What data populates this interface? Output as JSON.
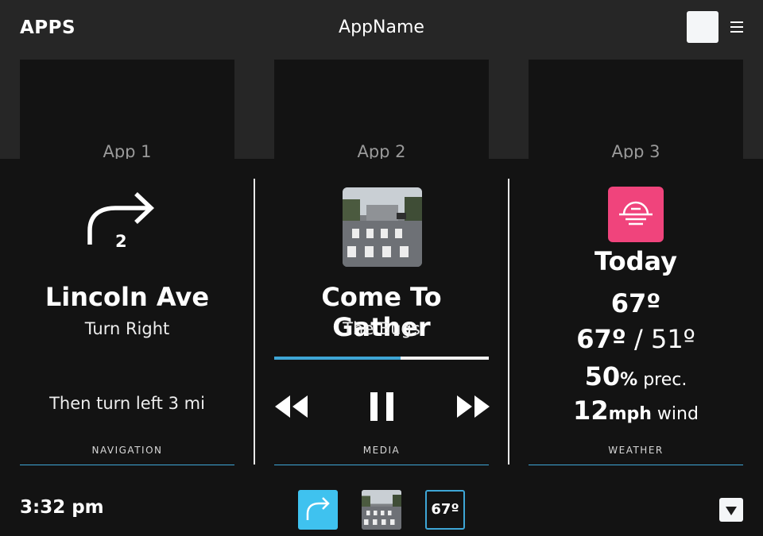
{
  "header": {
    "apps_label": "APPS",
    "app_name": "AppName"
  },
  "apps": [
    {
      "label": "App 1"
    },
    {
      "label": "App 2"
    },
    {
      "label": "App 3"
    }
  ],
  "navigation": {
    "turn_icon": "turn-right-arrow-icon",
    "turn_number": "2",
    "street": "Lincoln Ave",
    "maneuver": "Turn Right",
    "next_step": "Then turn left 3 mi",
    "footer": "NAVIGATION"
  },
  "media": {
    "album_art": "crosswalk-album-art",
    "song": "Come To Gather",
    "artist": "The Bugs",
    "progress": 0.59,
    "footer": "MEDIA"
  },
  "weather": {
    "icon": "sunset-icon",
    "day": "Today",
    "current_temp": "67º",
    "high": "67º",
    "separator": " / ",
    "low": "51º",
    "precip_value": "50",
    "precip_unit": "%",
    "precip_suffix": " prec.",
    "wind_value": "12",
    "wind_unit": "mph",
    "wind_suffix": " wind",
    "footer": "WEATHER"
  },
  "status": {
    "time": "3:32 pm",
    "dock_weather_temp": "67º"
  },
  "colors": {
    "accent": "#3ea6d6",
    "weather_pink": "#f0447c",
    "dock_nav_blue": "#3fc2ef"
  }
}
